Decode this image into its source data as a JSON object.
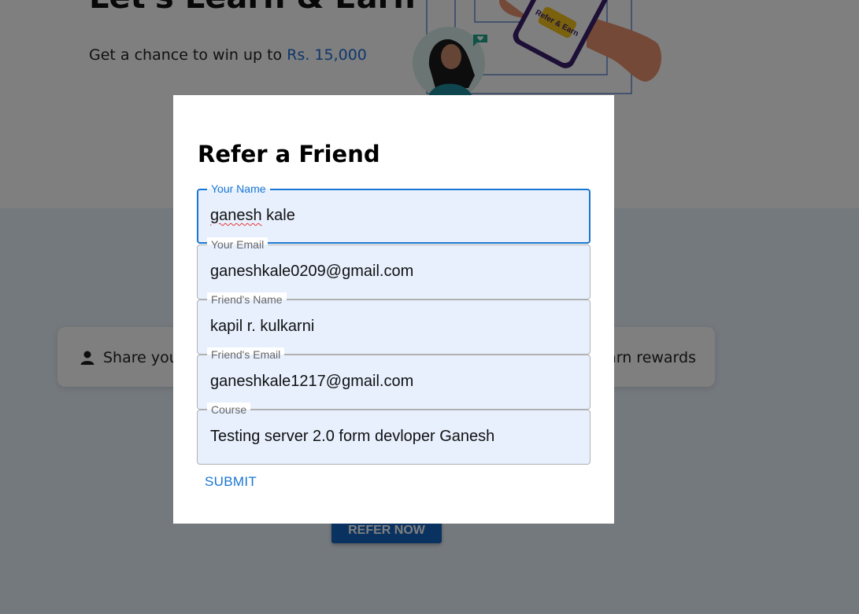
{
  "hero": {
    "title": "Let's Learn & Earn",
    "subtitle_prefix": "Get a chance to win up to",
    "subtitle_amount": "Rs. 15,000",
    "phone_badge": "Refer & Earn"
  },
  "steps": {
    "left_text": "Share you",
    "right_text": "arn rewards"
  },
  "refer_button": "REFER NOW",
  "dialog": {
    "title": "Refer a Friend",
    "fields": [
      {
        "label": "Your Name",
        "value": "ganesh kale",
        "misspelled_word": "ganesh",
        "rest": " kale"
      },
      {
        "label": "Your Email",
        "value": "ganeshkale0209@gmail.com"
      },
      {
        "label": "Friend's Name",
        "value": "kapil r. kulkarni"
      },
      {
        "label": "Friend's Email",
        "value": "ganeshkale1217@gmail.com"
      },
      {
        "label": "Course",
        "value": "Testing server 2.0 form devloper Ganesh"
      }
    ],
    "submit_label": "SUBMIT"
  },
  "colors": {
    "accent": "#1976d2",
    "field_bg": "#e8f0fe",
    "amount": "#1e6fd8",
    "refer_button": "#1565c0"
  }
}
